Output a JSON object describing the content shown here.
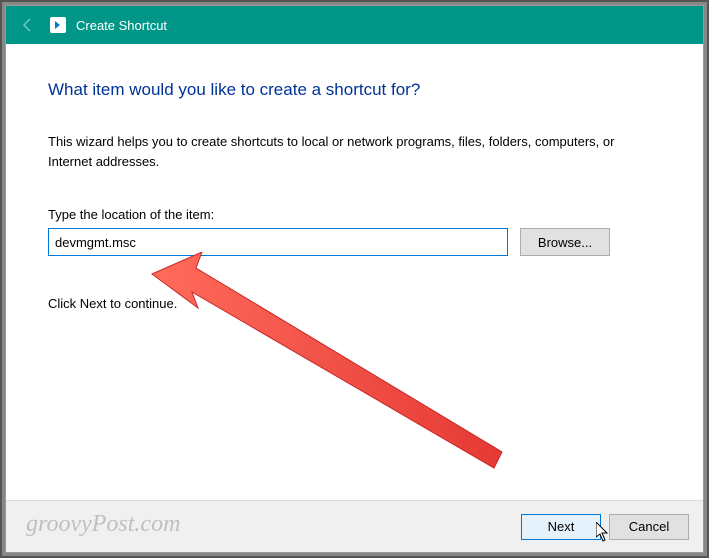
{
  "titlebar": {
    "title": "Create Shortcut"
  },
  "content": {
    "heading": "What item would you like to create a shortcut for?",
    "desc": "This wizard helps you to create shortcuts to local or network programs, files, folders, computers, or Internet addresses.",
    "location_label": "Type the location of the item:",
    "location_value": "devmgmt.msc",
    "browse_label": "Browse...",
    "continue_text": "Click Next to continue."
  },
  "footer": {
    "next_label": "Next",
    "cancel_label": "Cancel"
  },
  "watermark": "groovyPost.com",
  "colors": {
    "accent": "#009688",
    "link_blue": "#003399",
    "focus_border": "#0078d7",
    "arrow_red": "#f44336"
  }
}
